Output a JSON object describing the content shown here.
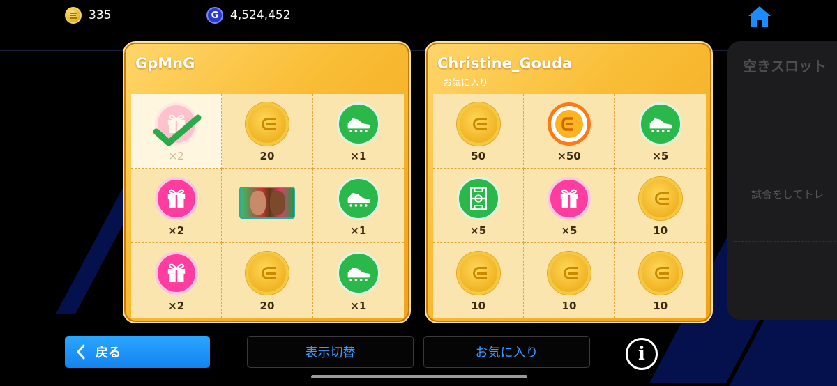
{
  "header": {
    "coins": "335",
    "gp": "4,524,452",
    "gp_icon_letter": "G",
    "home_icon": "home-icon"
  },
  "colors": {
    "accent_blue": "#1483ef",
    "card_gold": "#f9bd35",
    "coin_gold": "#f0b423",
    "gift_pink": "#ff3d9e",
    "boot_green": "#2bb84b"
  },
  "cards": [
    {
      "title": "GpMnG",
      "subtitle": "",
      "cells": [
        {
          "icon": "gift-icon",
          "qty": "×2",
          "claimed": true
        },
        {
          "icon": "coin-icon",
          "qty": "20"
        },
        {
          "icon": "boot-icon",
          "qty": "×1"
        },
        {
          "icon": "gift-icon",
          "qty": "×2"
        },
        {
          "icon": "player-card-icon",
          "qty": ""
        },
        {
          "icon": "boot-icon",
          "qty": "×1"
        },
        {
          "icon": "gift-icon",
          "qty": "×2"
        },
        {
          "icon": "coin-icon",
          "qty": "20"
        },
        {
          "icon": "boot-icon",
          "qty": "×1"
        }
      ]
    },
    {
      "title": "Christine_Gouda",
      "subtitle": "お気に入り",
      "cells": [
        {
          "icon": "coin-icon",
          "qty": "50"
        },
        {
          "icon": "ecoin-icon",
          "qty": "×50"
        },
        {
          "icon": "boot-icon",
          "qty": "×5"
        },
        {
          "icon": "pitch-icon",
          "qty": "×5"
        },
        {
          "icon": "gift-icon",
          "qty": "×5"
        },
        {
          "icon": "coin-icon",
          "qty": "10"
        },
        {
          "icon": "coin-icon",
          "qty": "10"
        },
        {
          "icon": "coin-icon",
          "qty": "10"
        },
        {
          "icon": "coin-icon",
          "qty": "10"
        }
      ]
    }
  ],
  "empty_slot": {
    "title": "空きスロット",
    "message": "試合をしてトレ"
  },
  "buttons": {
    "back": "戻る",
    "toggle_view": "表示切替",
    "favorites": "お気に入り",
    "info": "i"
  }
}
